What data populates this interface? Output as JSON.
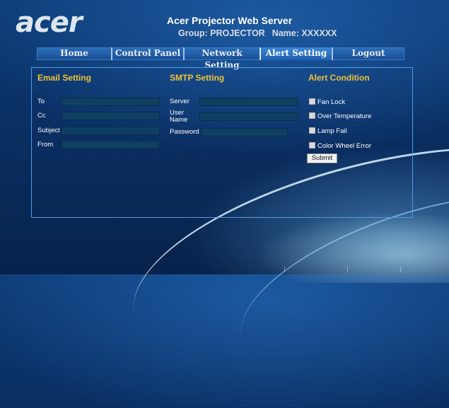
{
  "logo_text": "acer",
  "header": {
    "title": "Acer Projector Web Server",
    "group": "Group: PROJECTOR",
    "name": "Name: XXXXXX"
  },
  "nav": {
    "tabs": [
      {
        "label": "Home"
      },
      {
        "label": "Control Panel"
      },
      {
        "label": "Network Setting"
      },
      {
        "label": "Alert Setting",
        "active": true
      },
      {
        "label": "Logout"
      }
    ]
  },
  "email_setting": {
    "title": "Email Setting",
    "to_label": "To",
    "cc_label": "Cc",
    "subject_label": "Subject",
    "from_label": "From",
    "to_value": "",
    "cc_value": "",
    "subject_value": "",
    "from_value": ""
  },
  "smtp_setting": {
    "title": "SMTP Setting",
    "server_label": "Server",
    "user_name_label": "User\nName",
    "password_label": "Password",
    "server_value": "",
    "user_name_value": "",
    "password_value": ""
  },
  "alert_condition": {
    "title": "Alert Condition",
    "items": [
      {
        "label": "Fan Lock",
        "checked": false
      },
      {
        "label": "Over Temperature",
        "checked": false
      },
      {
        "label": "Lamp Fail",
        "checked": false
      },
      {
        "label": "Color Wheel Error",
        "checked": false
      }
    ],
    "submit_label": "Submit"
  },
  "colors": {
    "background": "#0a2f63",
    "section_title": "#f0c23a",
    "field_bg": "#0f3f62",
    "panel_border": "#4e9be6"
  }
}
